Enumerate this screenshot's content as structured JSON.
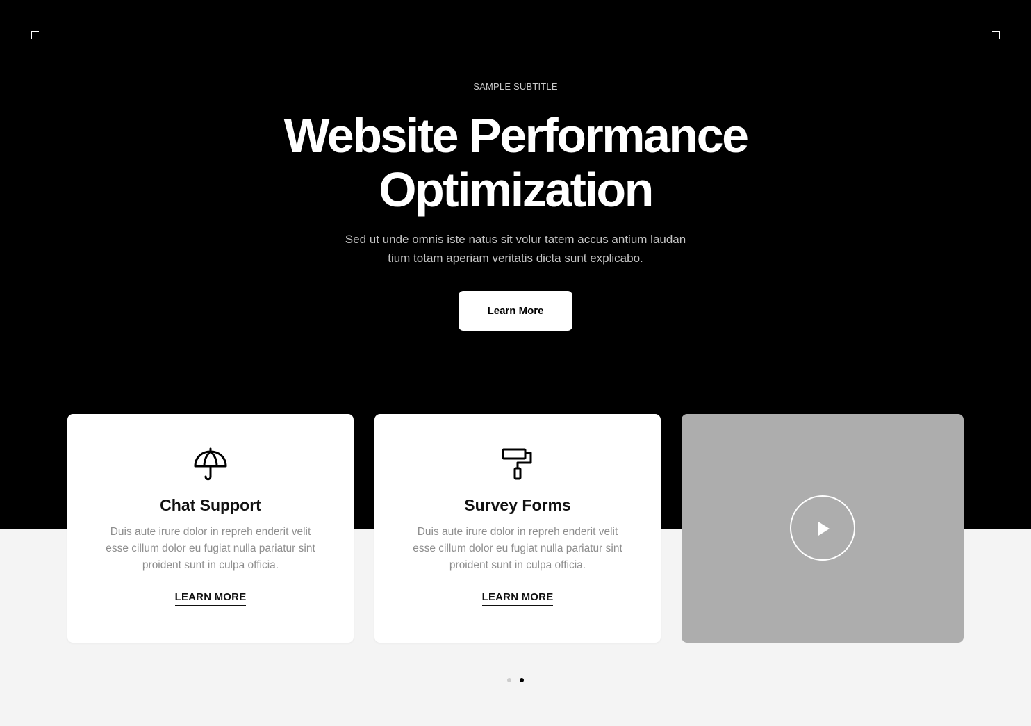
{
  "hero": {
    "subtitle": "SAMPLE SUBTITLE",
    "title_line_1": "Website Performance",
    "title_line_2": "Optimization",
    "description_line_1": "Sed ut unde omnis iste natus sit volur tatem accus antium laudan",
    "description_line_2": "tium totam aperiam veritatis dicta sunt explicabo.",
    "button_label": "Learn More"
  },
  "cards": [
    {
      "icon": "umbrella-icon",
      "title": "Chat Support",
      "description": "Duis aute irure dolor in repreh enderit velit esse cillum dolor eu fugiat nulla pariatur sint proident sunt in culpa officia.",
      "link_label": "LEARN MORE"
    },
    {
      "icon": "paint-roller-icon",
      "title": "Survey Forms",
      "description": "Duis aute irure dolor in repreh enderit velit esse cillum dolor eu fugiat nulla pariatur sint proident sunt in culpa officia.",
      "link_label": "LEARN MORE"
    }
  ],
  "video": {
    "icon": "play-icon"
  },
  "carousel": {
    "page_count": 2,
    "active_page": 2
  },
  "colors": {
    "hero_background": "#000000",
    "page_background": "#f4f4f4",
    "card_background": "#ffffff",
    "video_placeholder": "#adadad",
    "accent": "#ffffff"
  }
}
